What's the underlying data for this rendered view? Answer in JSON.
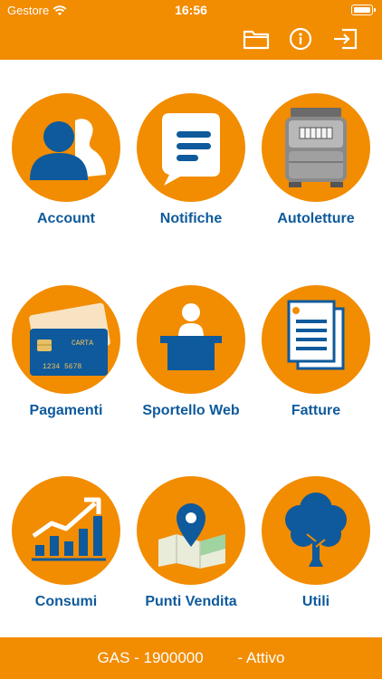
{
  "status_bar": {
    "carrier": "Gestore",
    "time": "16:56"
  },
  "toolbar": {
    "icons": [
      "folder-icon",
      "info-icon",
      "logout-icon"
    ]
  },
  "tiles": [
    {
      "label": "Account",
      "icon": "account-icon"
    },
    {
      "label": "Notifiche",
      "icon": "notifications-icon"
    },
    {
      "label": "Autoletture",
      "icon": "gas-meter-icon"
    },
    {
      "label": "Pagamenti",
      "icon": "credit-card-icon",
      "card_text": "CARTA",
      "card_number": "1234 5678"
    },
    {
      "label": "Sportello Web",
      "icon": "web-desk-icon"
    },
    {
      "label": "Fatture",
      "icon": "invoices-icon"
    },
    {
      "label": "Consumi",
      "icon": "consumption-chart-icon"
    },
    {
      "label": "Punti Vendita",
      "icon": "map-pin-icon"
    },
    {
      "label": "Utili",
      "icon": "tree-icon"
    }
  ],
  "footer": {
    "text": "GAS - 1900000        - Attivo"
  },
  "colors": {
    "brand": "#f28c00",
    "label": "#0e5a9c",
    "icon_blue": "#0e5a9c"
  }
}
